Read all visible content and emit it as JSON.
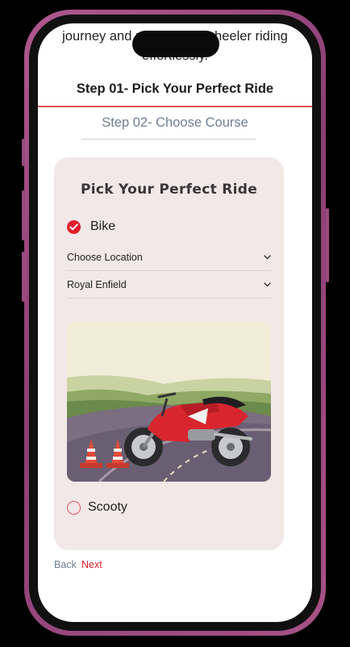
{
  "intro": {
    "line1": "journey and master two-wheeler riding",
    "line2": "effortlessly."
  },
  "steps": {
    "step1": "Step 01- Pick Your Perfect Ride",
    "step2": "Step 02- Choose Course"
  },
  "card": {
    "title": "Pick Your Perfect Ride",
    "options": [
      {
        "label": "Bike",
        "checked": true
      },
      {
        "label": "Scooty",
        "checked": false
      }
    ],
    "location_select": "Choose Location",
    "bike_select": "Royal Enfield"
  },
  "nav": {
    "back": "Back",
    "next": "Next"
  },
  "colors": {
    "accent": "#e31e2d",
    "card_bg": "#f2e8e8",
    "muted": "#6d7f95",
    "frame": "#a75287"
  },
  "icons": {
    "checked_radio": "check-circle-icon",
    "dropdown": "chevron-down-icon"
  }
}
